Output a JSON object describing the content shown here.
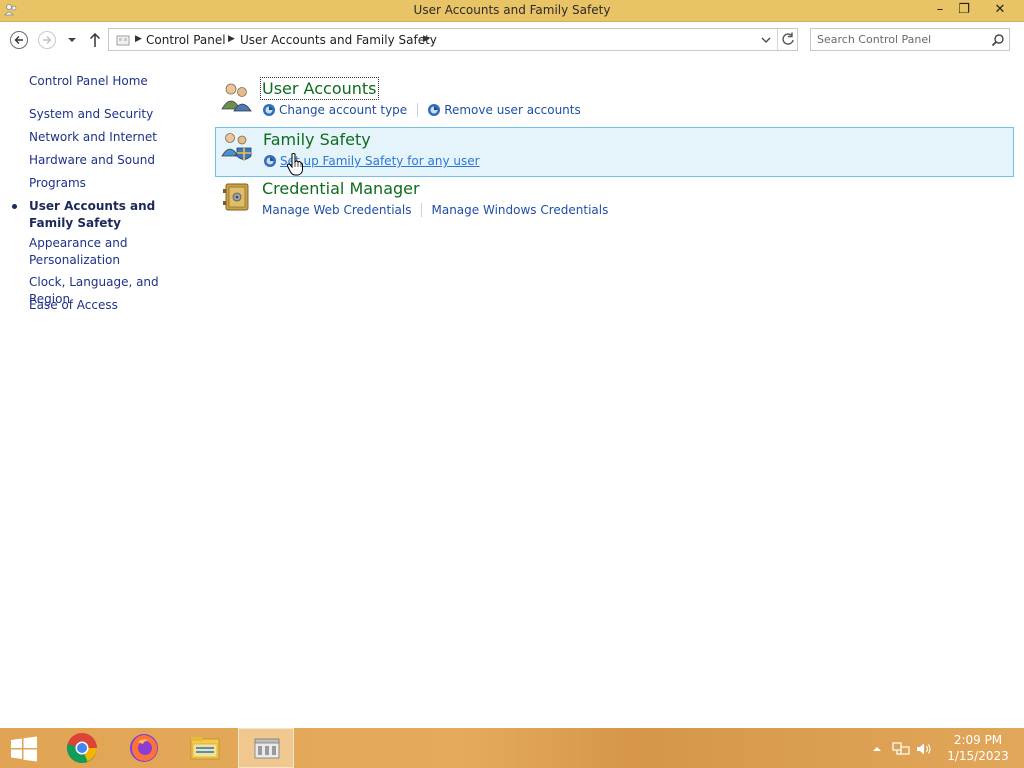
{
  "window": {
    "title": "User Accounts and Family Safety",
    "min_label": "–",
    "max_label": "❐",
    "close_label": "✕"
  },
  "address": {
    "crumbs": [
      "Control Panel",
      "User Accounts and Family Safety"
    ],
    "search_placeholder": "Search Control Panel"
  },
  "left_pane": {
    "items": [
      {
        "label": "Control Panel Home"
      },
      {
        "label": "System and Security"
      },
      {
        "label": "Network and Internet"
      },
      {
        "label": "Hardware and Sound"
      },
      {
        "label": "Programs"
      },
      {
        "label": "User Accounts and Family Safety",
        "current": true
      },
      {
        "label": "Appearance and Personalization"
      },
      {
        "label": "Clock, Language, and Region"
      },
      {
        "label": "Ease of Access"
      }
    ]
  },
  "categories": [
    {
      "title": "User Accounts",
      "icon": "users-icon",
      "links": [
        "Change account type",
        "Remove user accounts"
      ]
    },
    {
      "title": "Family Safety",
      "icon": "family-safety-icon",
      "links": [
        "Set up Family Safety for any user"
      ]
    },
    {
      "title": "Credential Manager",
      "icon": "vault-icon",
      "links": [
        "Manage Web Credentials",
        "Manage Windows Credentials"
      ]
    }
  ],
  "taskbar": {
    "time": "2:09 PM",
    "date": "1/15/2023",
    "apps": [
      "chrome-icon",
      "firefox-icon",
      "file-explorer-icon",
      "control-panel-icon"
    ]
  },
  "colors": {
    "titlebar": "#e9c467",
    "link": "#1f4fa8",
    "category_title": "#0e6c1e",
    "hover_bg": "#e5f3fb",
    "taskbar": "#e0a454"
  }
}
